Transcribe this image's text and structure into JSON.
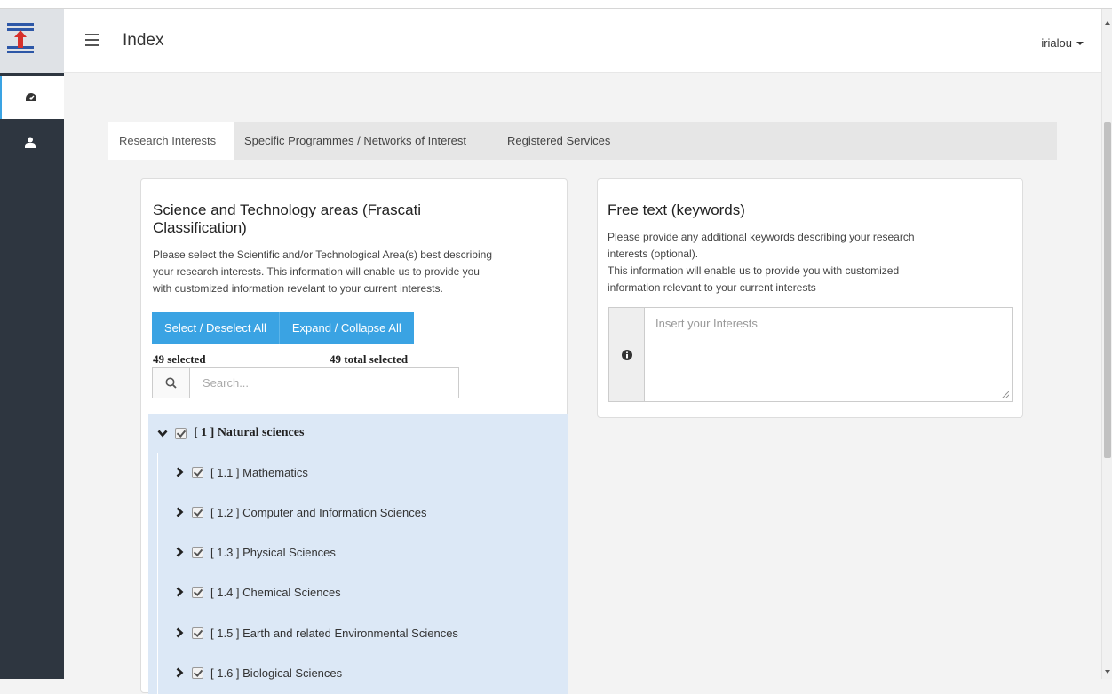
{
  "header": {
    "title": "Index",
    "user": "irialou"
  },
  "tabs": [
    {
      "label": "Research Interests",
      "active": true
    },
    {
      "label": "Specific Programmes / Networks of Interest",
      "active": false
    },
    {
      "label": "Registered Services",
      "active": false
    }
  ],
  "science_panel": {
    "title_line1": "Science and Technology areas (Frascati",
    "title_line2": "Classification)",
    "desc_line1": "Please select the Scientific and/or Technological Area(s) best describing",
    "desc_line2": "your research interests. This information will enable us to provide you",
    "desc_line3": "with customized information revelant to your current interests.",
    "select_all_label": "Select / Deselect All",
    "expand_all_label": "Expand / Collapse All",
    "selected_count": "49 selected",
    "total_selected": "49 total selected",
    "search_placeholder": "Search...",
    "tree": {
      "root": {
        "label": "[ 1 ] Natural sciences",
        "checked": true,
        "expanded": true
      },
      "children": [
        {
          "label": "[ 1.1 ] Mathematics",
          "checked": true
        },
        {
          "label": "[ 1.2 ] Computer and Information Sciences",
          "checked": true
        },
        {
          "label": "[ 1.3 ] Physical Sciences",
          "checked": true
        },
        {
          "label": "[ 1.4 ] Chemical Sciences",
          "checked": true
        },
        {
          "label": "[ 1.5 ] Earth and related Environmental Sciences",
          "checked": true
        },
        {
          "label": "[ 1.6 ] Biological Sciences",
          "checked": true
        }
      ]
    }
  },
  "keywords_panel": {
    "title": "Free text (keywords)",
    "desc_line1": "Please provide any additional keywords describing your research",
    "desc_line2": "interests (optional).",
    "desc_line3": "This information will enable us to provide you with customized",
    "desc_line4": "information relevant to your current interests",
    "textarea_placeholder": "Insert your Interests"
  },
  "colors": {
    "sidebar_bg": "#2e3640",
    "accent": "#3aa3e3",
    "tree_bg": "#dce8f6"
  }
}
